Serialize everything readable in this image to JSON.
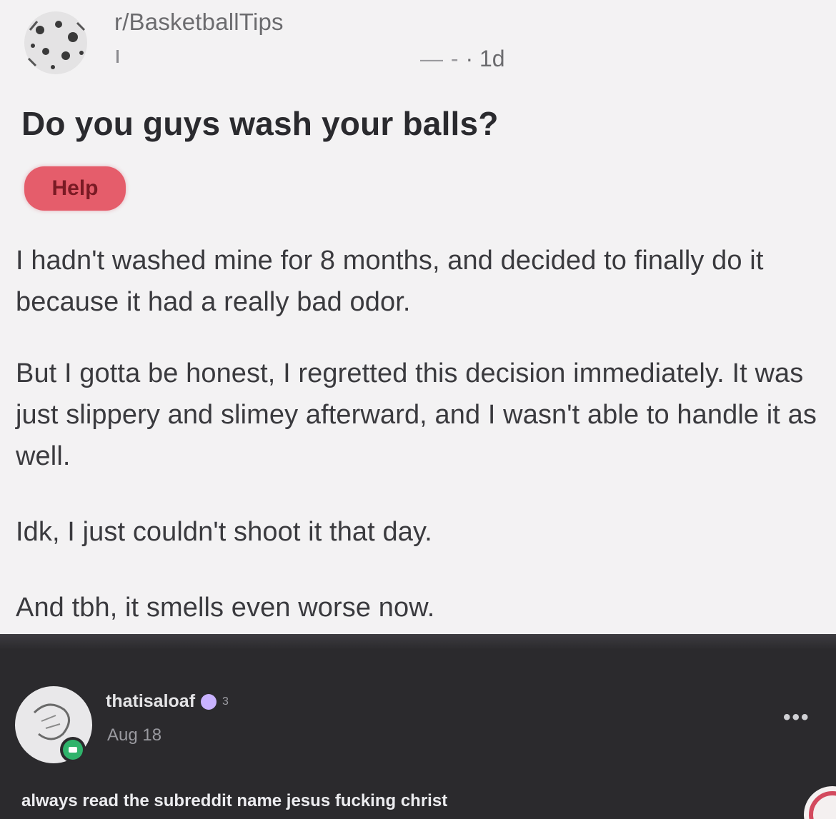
{
  "post": {
    "subreddit": "r/BasketballTips",
    "author_placeholder": "— -",
    "separator": "·",
    "age": "1d",
    "title": "Do you guys wash your balls?",
    "flair": "Help",
    "paragraphs": [
      "I hadn't washed mine for 8 months, and decided to finally do it because it had a really bad odor.",
      "But I gotta be honest, I regretted this decision immediately. It was just slippery and slimey afterward, and I wasn't able to handle it as well.",
      "Idk, I just couldn't shoot it that day.",
      "And tbh, it smells even worse now."
    ]
  },
  "comment": {
    "username": "thatisaloaf",
    "badge_count": "3",
    "date": "Aug 18",
    "more_label": "•••",
    "text": "always read the subreddit name jesus fucking christ"
  },
  "colors": {
    "flair_bg": "#e55d6b",
    "comment_bg": "#2b2a2d",
    "post_bg": "#f3f2f3",
    "badge": "#c9b2ff"
  }
}
